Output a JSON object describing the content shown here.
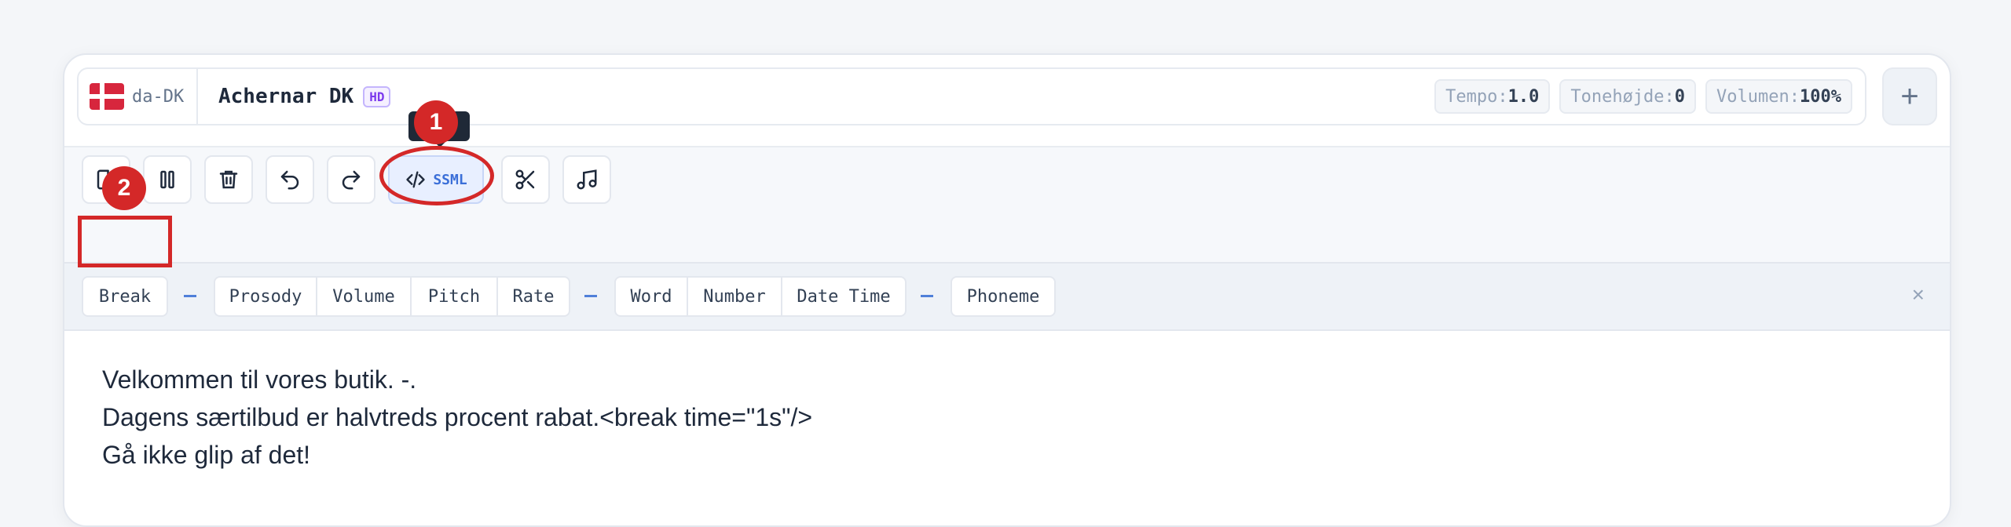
{
  "header": {
    "language_code": "da-DK",
    "voice_name": "Achernar DK",
    "quality_badge": "HD",
    "params": [
      {
        "label": "Tempo:",
        "value": "1.0"
      },
      {
        "label": "Tonehøjde:",
        "value": "0"
      },
      {
        "label": "Volumen:",
        "value": "100%"
      }
    ],
    "add_label": "+"
  },
  "toolbar": {
    "ssml_label": "SSML"
  },
  "annotations": {
    "step1": "1",
    "step2": "2"
  },
  "tags": {
    "break": "Break",
    "prosody": "Prosody",
    "volume": "Volume",
    "pitch": "Pitch",
    "rate": "Rate",
    "word": "Word",
    "number": "Number",
    "date_time": "Date Time",
    "phoneme": "Phoneme",
    "close": "×"
  },
  "editor": {
    "lines": [
      "Velkommen til vores butik. -.",
      "Dagens særtilbud er halvtreds procent rabat.<break time=\"1s\"/>",
      "Gå ikke glip af det!"
    ]
  },
  "colors": {
    "accent": "#3b6fd8",
    "annotation_red": "#d42828",
    "hd_purple": "#7c3aed"
  }
}
